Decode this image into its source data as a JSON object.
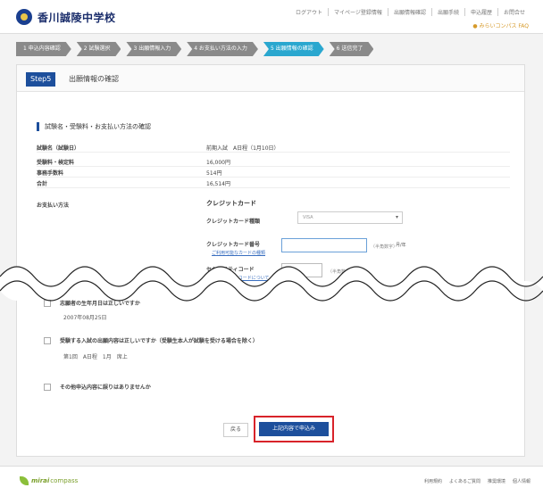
{
  "header": {
    "logo_text": "香川誠陵中学校",
    "links": [
      "ログアウト",
      "マイページ登録情報",
      "出願情報確認",
      "出願手続",
      "申込履歴",
      "お問合せ"
    ],
    "sub_link": "● みらいコンパス FAQ"
  },
  "steps": [
    "1 申込内容確認",
    "2 試験選択",
    "3 出願情報入力",
    "4 お支払い方法の入力",
    "5 出願情報の確認",
    "6 送信完了"
  ],
  "card": {
    "step_badge": "Step5",
    "title": "出願情報の確認",
    "section_title": "試験名・受験料・お支払い方法の確認",
    "rows": [
      {
        "label": "試験名（試験日）",
        "value": "前期入試　A日程（1月10日）"
      },
      {
        "label": "受験料・検定料",
        "value": "16,000円"
      },
      {
        "label": "事務手数料",
        "value": "514円"
      },
      {
        "label": "合計",
        "value": "16,514円"
      }
    ],
    "payment_label": "お支払い方法",
    "cc_title": "クレジットカード",
    "card_type_label": "クレジットカード種類",
    "card_type_value": "VISA",
    "card_number_label": "クレジットカード番号",
    "card_number_link": "ご利用可能なカードの種類",
    "card_number_hint": "（半角数字）",
    "expiry_hint": "月/年",
    "security_label": "セキュリティコード",
    "security_link": "セキュリティコードについて",
    "security_hint": "（半角数字）"
  },
  "checks": [
    {
      "label": "志願者の生年月日は正しいですか",
      "sub": "2007年08月25日"
    },
    {
      "label": "受験する入試の出願内容は正しいですか（受験生本人が試験を受ける場合を除く）",
      "sub": "第1回　A日程　1月　席上"
    },
    {
      "label": "その他申込内容に誤りはありませんか",
      "sub": ""
    }
  ],
  "buttons": {
    "back": "戻る",
    "submit": "上記内容で申込み"
  },
  "footer": {
    "logo_prefix": "",
    "logo_brand": "mirai",
    "logo_suffix": "compass",
    "links": [
      "利用規約",
      "よくあるご質問",
      "推奨環境",
      "個人情報"
    ]
  },
  "colors": {
    "primary": "#1d4f9c",
    "active_step": "#2aa7cf",
    "highlight_border": "#d8232a",
    "brand_green": "#8bbf3a"
  }
}
